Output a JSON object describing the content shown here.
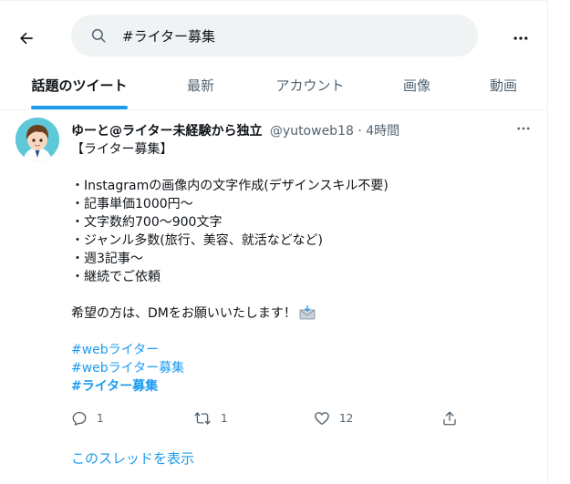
{
  "search": {
    "query": "#ライター募集"
  },
  "tabs": [
    {
      "label": "話題のツイート"
    },
    {
      "label": "最新"
    },
    {
      "label": "アカウント"
    },
    {
      "label": "画像"
    },
    {
      "label": "動画"
    }
  ],
  "tweet": {
    "name": "ゆーと@ライター未経験から独立",
    "handle": "@yutoweb18",
    "separator": "·",
    "time": "4時間",
    "lines": {
      "l1": "【ライター募集】",
      "l2": "・Instagramの画像内の文字作成(デザインスキル不要)",
      "l3": "・記事単価1000円〜",
      "l4": "・文字数約700〜900文字",
      "l5": "・ジャンル多数(旅行、美容、就活などなど)",
      "l6": "・週3記事〜",
      "l7": "・継続でご依頼",
      "l8": "希望の方は、DMをお願いいたします！"
    },
    "hashtags": [
      "#webライター",
      "#webライター募集",
      "#ライター募集"
    ],
    "reply_count": "1",
    "retweet_count": "1",
    "like_count": "12",
    "thread_link": "このスレッドを表示"
  },
  "colors": {
    "accent": "#1d9bf0",
    "text": "#0f1419",
    "secondary": "#536471",
    "search_bg": "#eff3f4"
  },
  "icons": {
    "back": "arrow-left-icon",
    "search": "search-icon",
    "more": "more-horizontal-icon",
    "reply": "reply-icon",
    "retweet": "retweet-icon",
    "like": "heart-icon",
    "share": "share-icon",
    "envelope": "incoming-envelope-emoji"
  }
}
